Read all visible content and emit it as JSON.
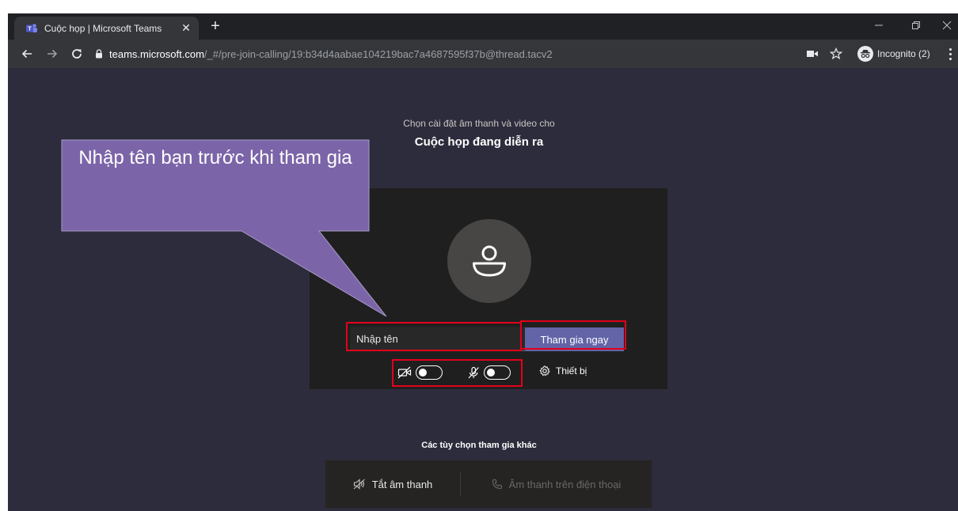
{
  "browser": {
    "tab_title": "Cuộc họp | Microsoft Teams",
    "url_host": "teams.microsoft.com",
    "url_path": "/_#/pre-join-calling/19:b34d4aabae104219bac7a4687595f37b@thread.tacv2",
    "incognito_label": "Incognito (2)"
  },
  "page": {
    "subtitle": "Chọn cài đặt âm thanh và video cho",
    "meeting_title": "Cuộc họp đang diễn ra",
    "name_placeholder": "Nhập tên",
    "join_button": "Tham gia ngay",
    "devices_label": "Thiết bị",
    "video_toggle_on": false,
    "mic_toggle_on": false,
    "other_options_title": "Các tùy chọn tham gia khác",
    "audio_off_label": "Tắt âm thanh",
    "phone_audio_label": "Âm thanh trên điện thoại"
  },
  "callout": {
    "text": "Nhập tên bạn trước khi tham gia",
    "color": "#7b65a8"
  },
  "colors": {
    "page_bg": "#2d2c3c",
    "card_bg": "#201f1f",
    "accent": "#6264a7",
    "highlight_box": "#e3001b"
  }
}
